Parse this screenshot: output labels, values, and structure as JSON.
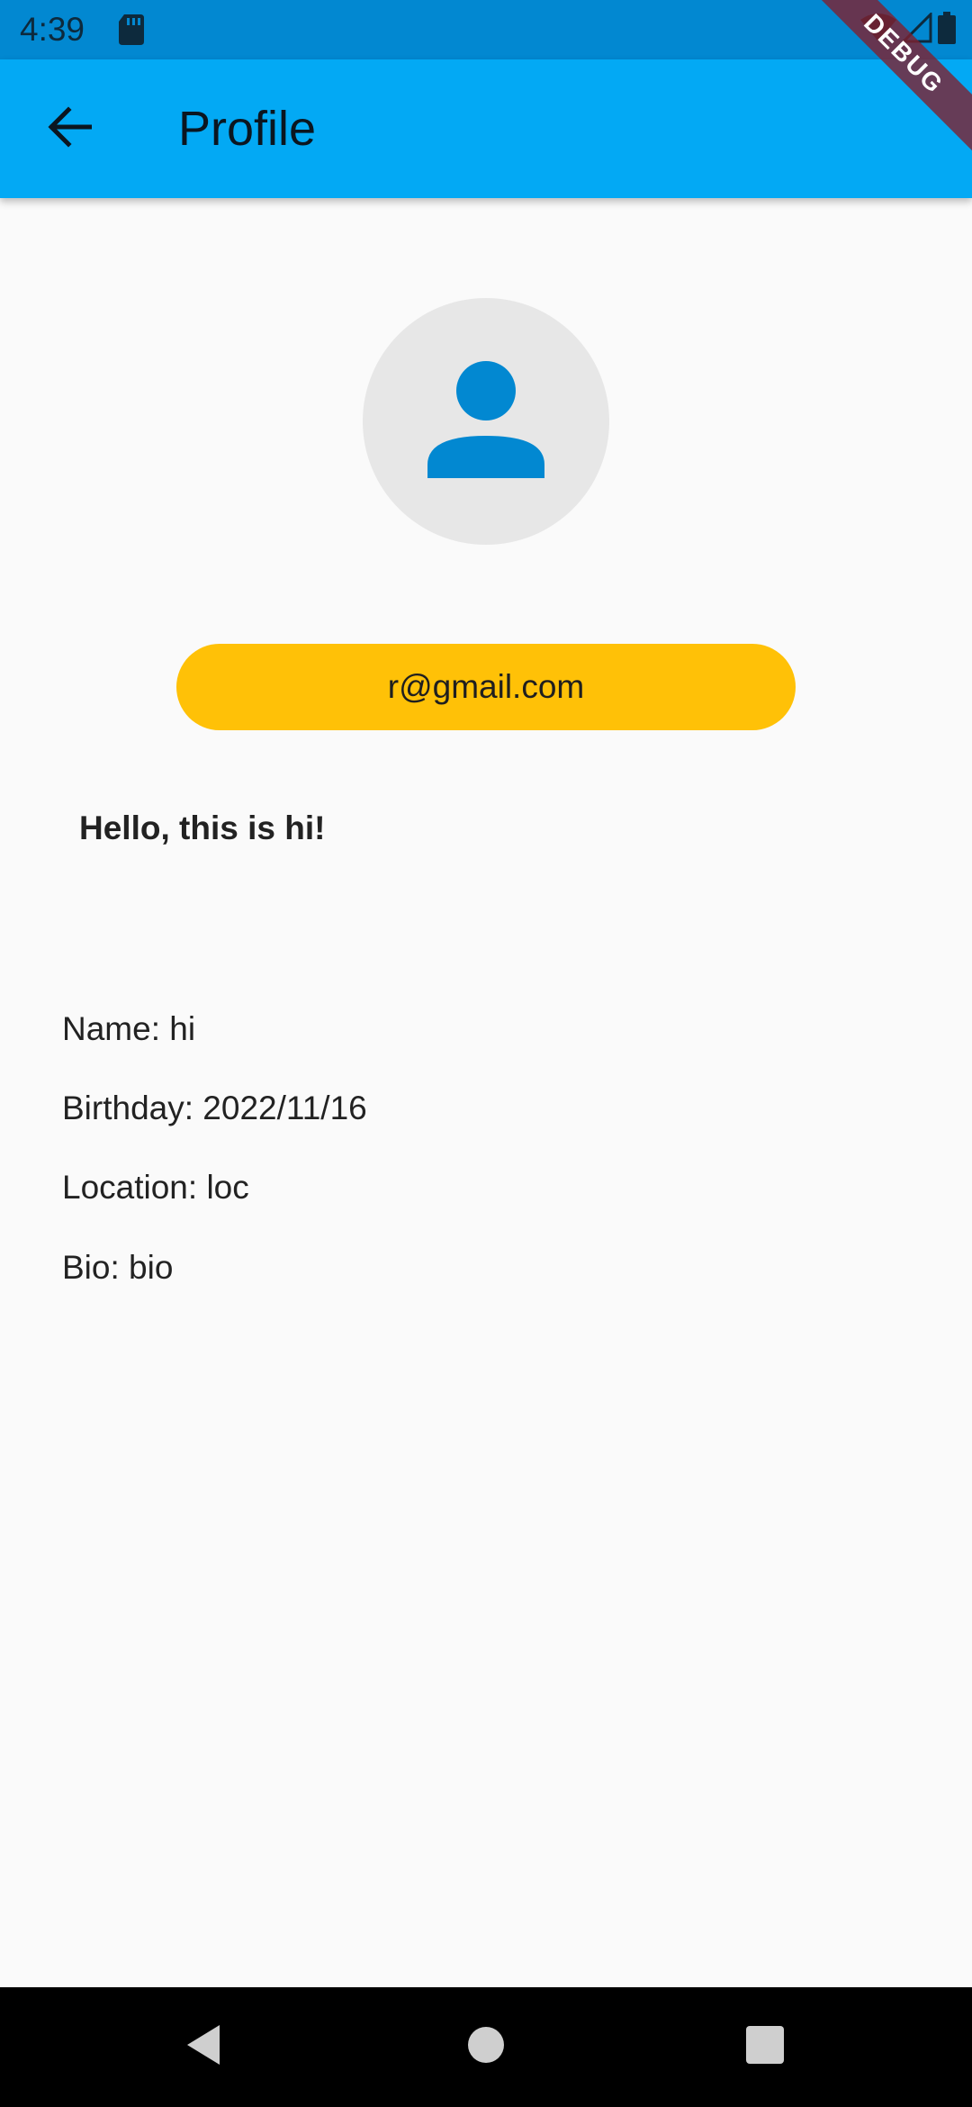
{
  "status_bar": {
    "time": "4:39",
    "icons": [
      "sd-card-icon",
      "wifi-icon",
      "signal-icon",
      "battery-icon"
    ]
  },
  "app_bar": {
    "title": "Profile",
    "back_icon": "arrow-back-icon",
    "color": "#03a9f4"
  },
  "debug_banner": "DEBUG",
  "profile": {
    "avatar_icon": "person-icon",
    "email": "r@gmail.com",
    "greeting": "Hello, this is hi!",
    "name": "Name: hi",
    "birthday": "Birthday: 2022/11/16",
    "location": "Location: loc",
    "bio": "Bio: bio"
  },
  "colors": {
    "accent": "#ffc107",
    "avatar_icon": "#0288d1",
    "status_bar": "#0288d1"
  },
  "nav_bar": {
    "buttons": [
      "back-nav-icon",
      "home-nav-icon",
      "recents-nav-icon"
    ]
  }
}
